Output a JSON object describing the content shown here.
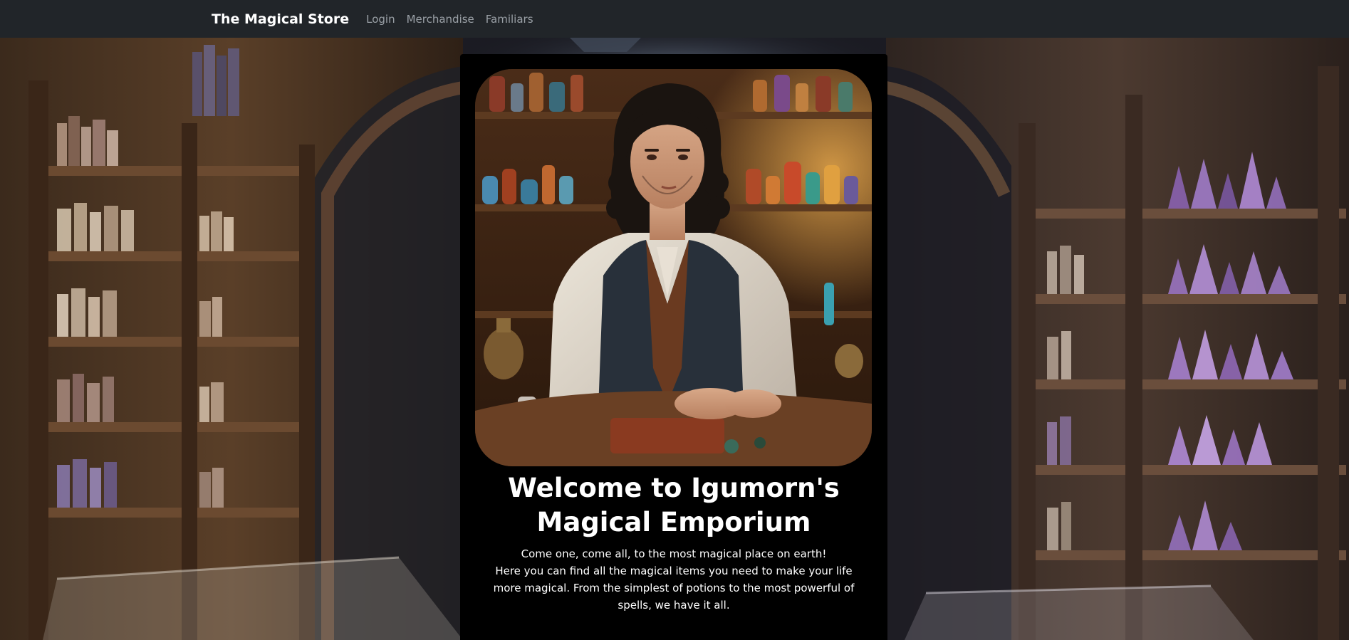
{
  "nav": {
    "brand": "The Magical Store",
    "links": [
      "Login",
      "Merchandise",
      "Familiars"
    ]
  },
  "hero": {
    "image_alt": "shopkeeper-portrait",
    "title_line1": "Welcome to Igumorn's",
    "title_line2": "Magical Emporium",
    "tagline": "Come one, come all, to the most magical place on earth!",
    "description": "Here you can find all the magical items you need to make your life more magical. From the simplest of potions to the most powerful of spells, we have it all."
  },
  "colors": {
    "navbar_bg": "#212529",
    "nav_link": "#9aa0a6",
    "card_bg": "#000000",
    "text": "#ffffff"
  }
}
